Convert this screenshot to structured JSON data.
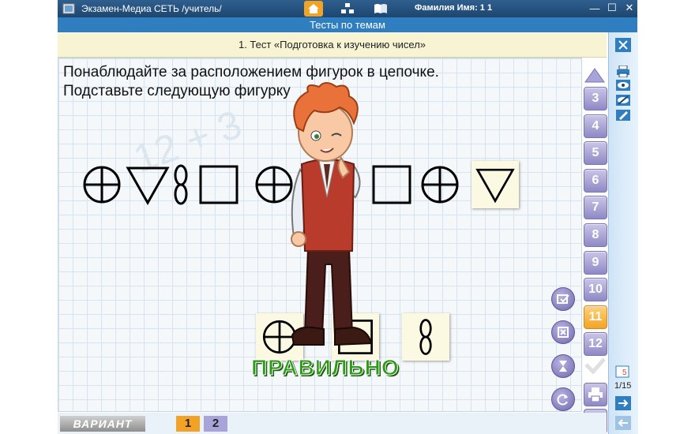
{
  "window": {
    "app_title": "Экзамен-Медиа СЕТЬ /учитель/",
    "user_label": "Фамилия Имя:   1  1",
    "min_label": "—",
    "max_label": "☐",
    "close_label": "✕"
  },
  "section_title": "Тесты по темам",
  "test_title": "1. Тест «Подготовка к изучению чисел»",
  "question": {
    "line1": "Понаблюдайте за расположением фигурок в цепочке.",
    "line2": "Подставьте следующую фигурку"
  },
  "sequence": [
    "circle-cross",
    "triangle",
    "figure-eight",
    "square",
    "circle-cross",
    "triangle",
    "figure-eight",
    "square",
    "circle-cross",
    "triangle"
  ],
  "answer_options": [
    "circle-cross",
    "square",
    "figure-eight"
  ],
  "feedback": "ПРАВИЛЬНО",
  "question_numbers": [
    "3",
    "4",
    "5",
    "6",
    "7",
    "8",
    "9",
    "10",
    "11",
    "12"
  ],
  "active_question": "11",
  "counter": "1/15",
  "variant": {
    "label": "ВАРИАНТ",
    "options": [
      "1",
      "2"
    ],
    "selected": "1"
  },
  "colors": {
    "titlebar": "#1d4670",
    "section": "#2f7fc0",
    "active": "#f2a325",
    "feedback": "#2e9a18"
  },
  "icons": [
    "home-icon",
    "structure-icon",
    "book-icon",
    "close-icon",
    "printer-icon",
    "eye-icon",
    "hidden-eye-icon",
    "pencil-icon",
    "arrow-right-icon",
    "arrow-left-icon",
    "book-stack-icon"
  ]
}
